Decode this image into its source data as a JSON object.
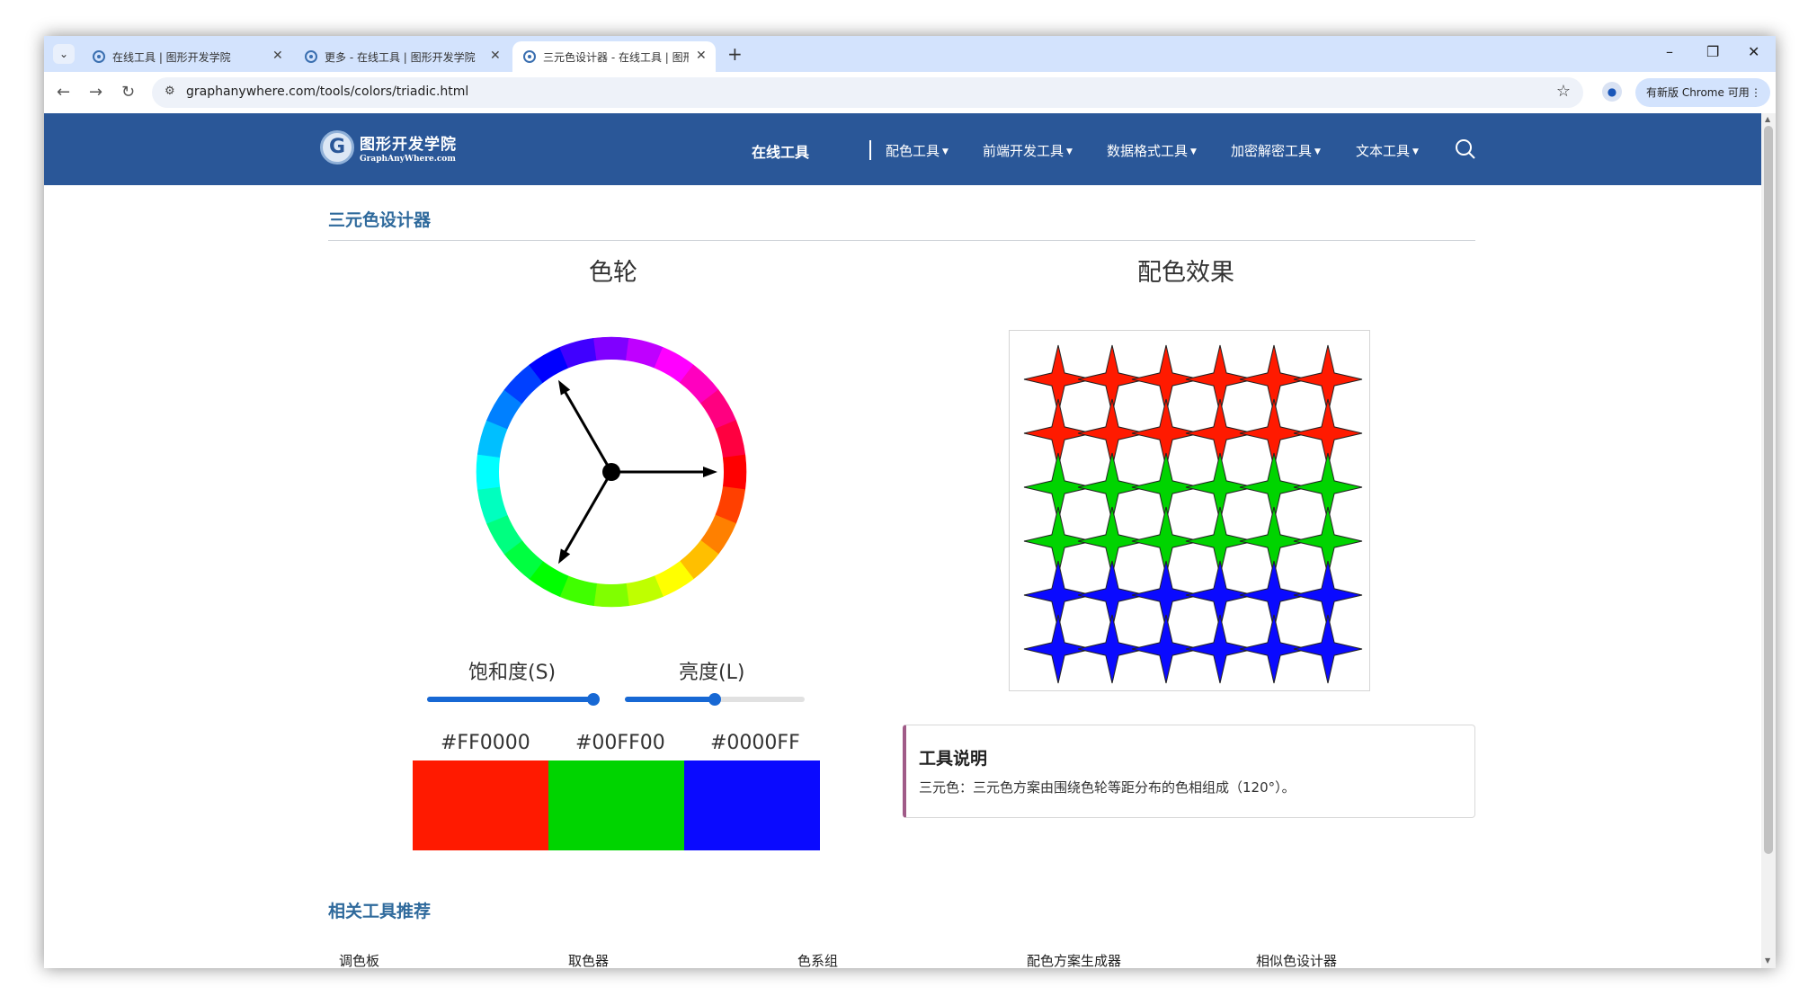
{
  "browser": {
    "tabs": [
      {
        "title": "在线工具 | 图形开发学院",
        "active": false
      },
      {
        "title": "更多 - 在线工具 | 图形开发学院",
        "active": false
      },
      {
        "title": "三元色设计器 - 在线工具 | 图形",
        "active": true
      }
    ],
    "url": "graphanywhere.com/tools/colors/triadic.html",
    "update_button": "有新版 Chrome 可用",
    "icons": {
      "new_tab": "+",
      "minimize": "–",
      "restore": "❐",
      "close": "✕",
      "back": "←",
      "forward": "→",
      "reload": "↻",
      "star": "☆",
      "menu": "⋮"
    }
  },
  "site": {
    "logo": {
      "name_cn": "图形开发学院",
      "name_en": "GraphAnyWhere.com"
    },
    "nav": {
      "main": "在线工具",
      "items": [
        "配色工具",
        "前端开发工具",
        "数据格式工具",
        "加密解密工具",
        "文本工具"
      ]
    }
  },
  "page": {
    "title": "三元色设计器",
    "wheel_title": "色轮",
    "preview_title": "配色效果",
    "saturation_label": "饱和度(S)",
    "lightness_label": "亮度(L)",
    "saturation_value": 1.0,
    "lightness_value": 0.5,
    "colors": [
      {
        "hex": "#FF0000",
        "swatch": "#ff1a00"
      },
      {
        "hex": "#00FF00",
        "swatch": "#00d400"
      },
      {
        "hex": "#0000FF",
        "swatch": "#0a0aff"
      }
    ],
    "pointer_hues_deg": [
      0,
      120,
      240
    ],
    "info": {
      "title": "工具说明",
      "text": "三元色：三元色方案由围绕色轮等距分布的色相组成（120°）。"
    },
    "related": {
      "title": "相关工具推荐",
      "items": [
        "调色板",
        "取色器",
        "色系组",
        "配色方案生成器",
        "相似色设计器"
      ]
    }
  },
  "colors": {
    "header_bg": "#2a5798",
    "accent": "#2f6a9c",
    "slider": "#1768d4",
    "preview_rows": [
      "#ff1a00",
      "#ff1a00",
      "#00d400",
      "#00d400",
      "#0a0aff",
      "#0a0aff"
    ]
  }
}
